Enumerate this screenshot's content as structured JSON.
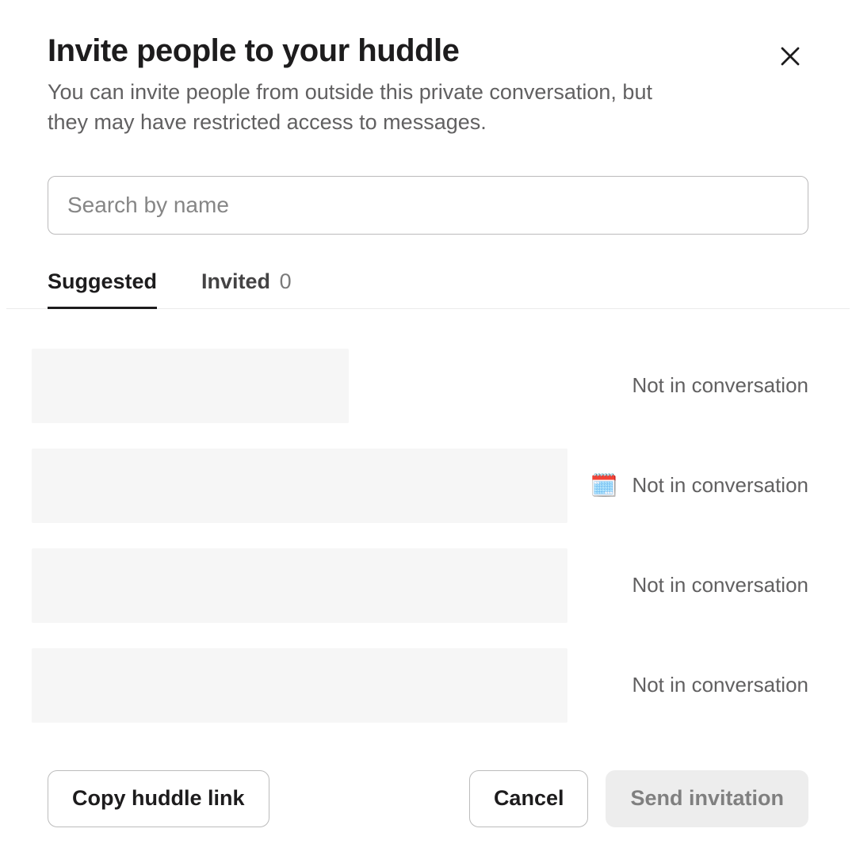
{
  "header": {
    "title": "Invite people to your huddle",
    "subtitle": "You can invite people from outside this private conversation, but they may have restricted access to messages."
  },
  "search": {
    "placeholder": "Search by name",
    "value": ""
  },
  "tabs": {
    "suggested_label": "Suggested",
    "invited_label": "Invited",
    "invited_count": "0"
  },
  "suggested": [
    {
      "status_text": "Not in conversation",
      "status_emoji": "",
      "placeholder_width": 400
    },
    {
      "status_text": "Not in conversation",
      "status_emoji": "🗓️",
      "placeholder_width": 676
    },
    {
      "status_text": "Not in conversation",
      "status_emoji": "",
      "placeholder_width": 676
    },
    {
      "status_text": "Not in conversation",
      "status_emoji": "",
      "placeholder_width": 676
    }
  ],
  "footer": {
    "copy_link_label": "Copy huddle link",
    "cancel_label": "Cancel",
    "send_label": "Send invitation"
  }
}
